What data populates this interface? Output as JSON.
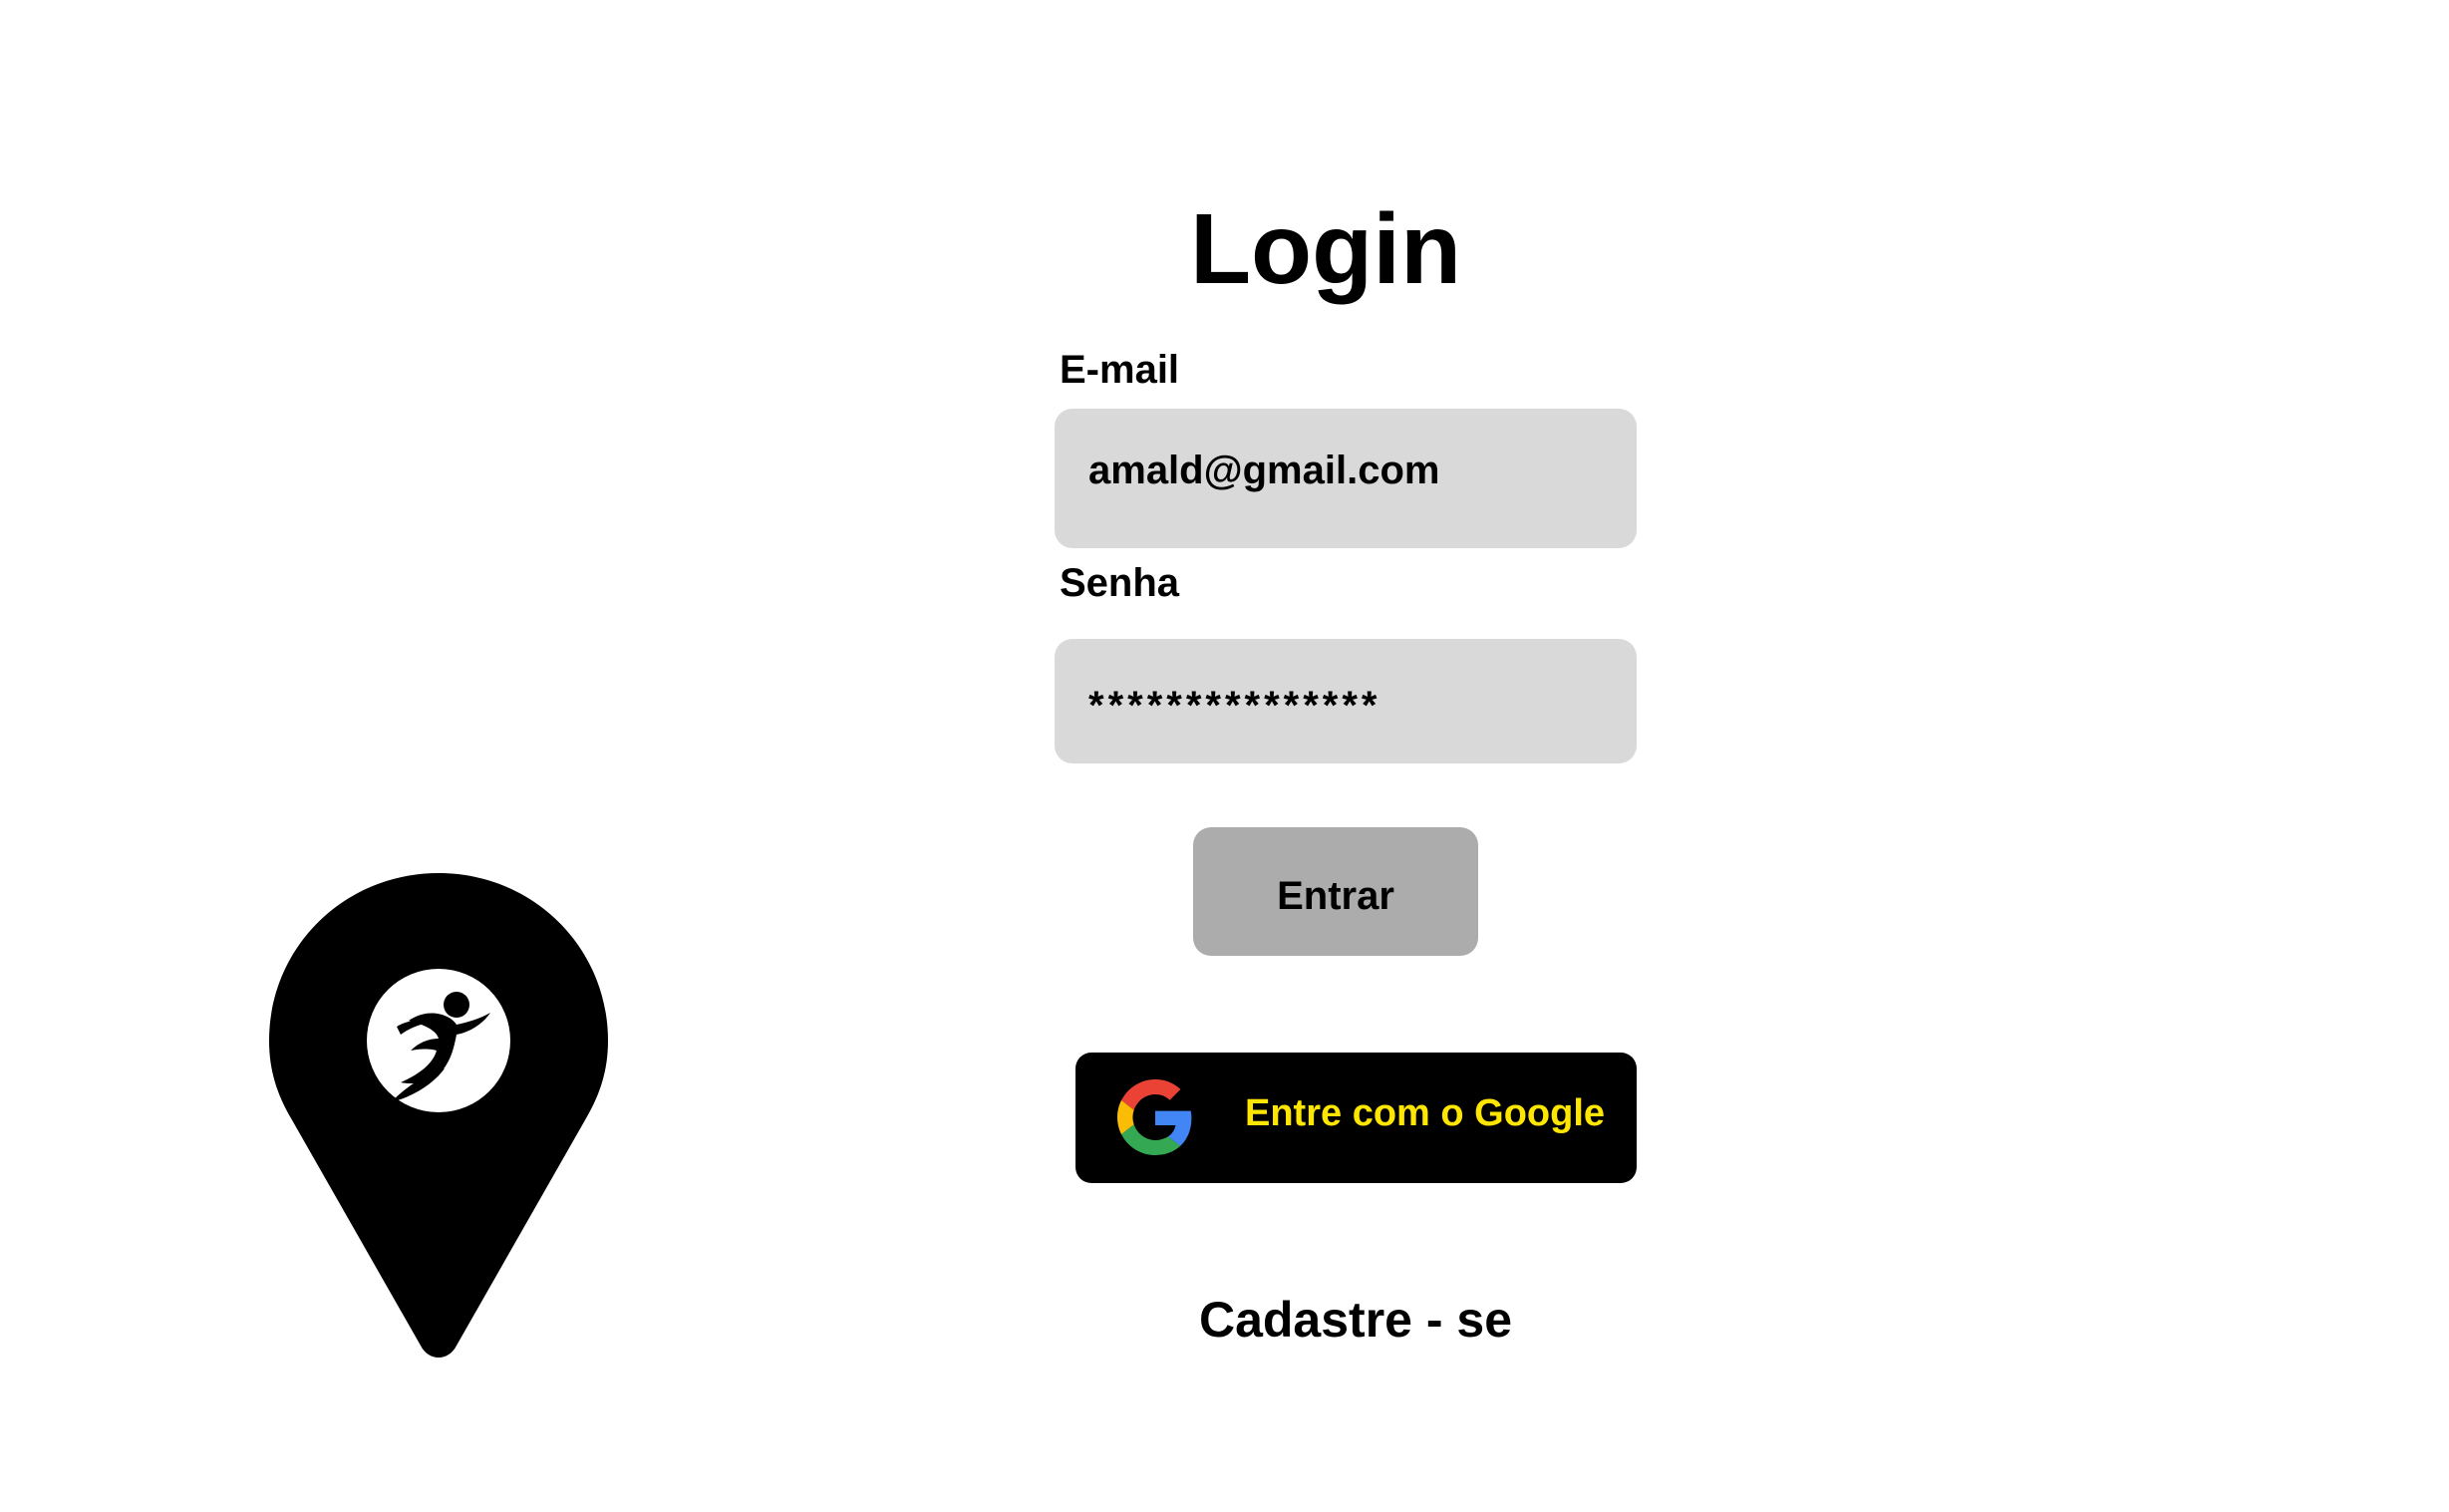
{
  "logo": {
    "icon": "map-pin-runner-icon"
  },
  "login": {
    "title": "Login",
    "email_label": "E-mail",
    "email_value": "amald@gmail.com",
    "password_label": "Senha",
    "password_value": "***************",
    "submit_label": "Entrar",
    "google_label": "Entre com o Google",
    "google_icon": "google-icon",
    "signup_label": "Cadastre - se"
  },
  "colors": {
    "background": "#ffffff",
    "input_fill": "#d9d9d9",
    "submit_fill": "#acacac",
    "google_button_fill": "#000000",
    "google_text": "#ffe600"
  }
}
